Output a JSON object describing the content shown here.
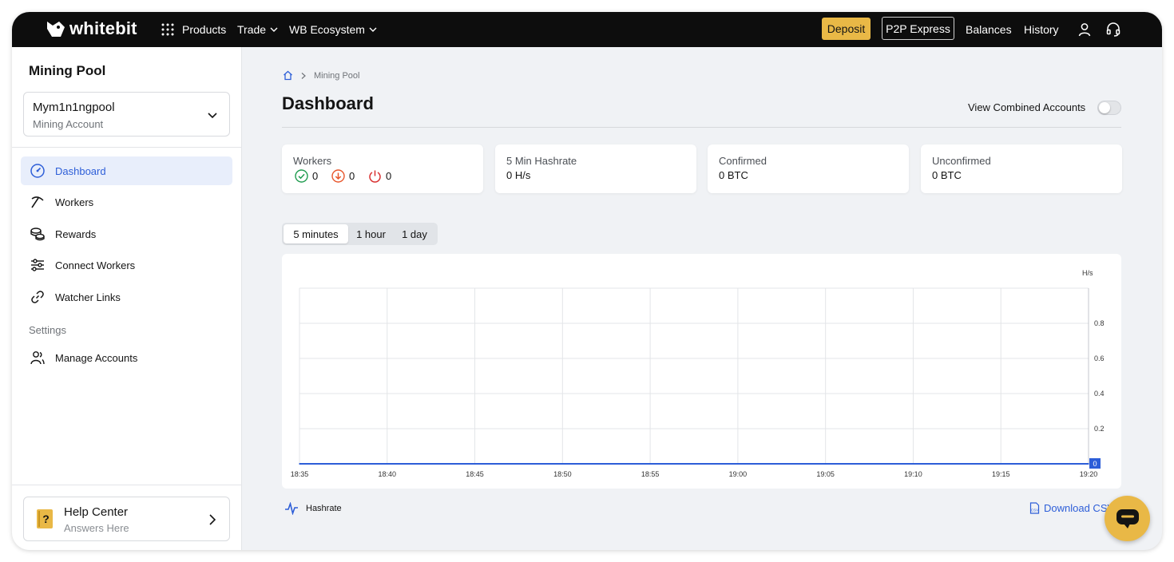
{
  "topbar": {
    "logo_text": "whitebit",
    "nav": [
      "Products",
      "Trade",
      "WB Ecosystem"
    ],
    "deposit_label": "Deposit",
    "p2p_label": "P2P Express",
    "balances_label": "Balances",
    "history_label": "History",
    "icons": [
      "grid-icon",
      "user-icon",
      "headset-icon"
    ]
  },
  "sidebar": {
    "title": "Mining Pool",
    "account": {
      "name": "Mym1n1ngpool",
      "type": "Mining Account"
    },
    "items": [
      {
        "label": "Dashboard",
        "icon": "gauge-icon",
        "active": true
      },
      {
        "label": "Workers",
        "icon": "pickaxe-icon",
        "active": false
      },
      {
        "label": "Rewards",
        "icon": "coins-icon",
        "active": false
      },
      {
        "label": "Connect Workers",
        "icon": "sliders-icon",
        "active": false
      },
      {
        "label": "Watcher Links",
        "icon": "link-icon",
        "active": false
      }
    ],
    "settings_label": "Settings",
    "settings_items": [
      {
        "label": "Manage Accounts",
        "icon": "users-icon"
      }
    ],
    "help": {
      "title": "Help Center",
      "subtitle": "Answers Here"
    }
  },
  "main": {
    "breadcrumb": [
      "Mining Pool"
    ],
    "title": "Dashboard",
    "combined_label": "View Combined Accounts",
    "combined_enabled": false,
    "cards": {
      "workers": {
        "label": "Workers",
        "online": "0",
        "offline": "0",
        "dead": "0"
      },
      "hashrate": {
        "label": "5 Min Hashrate",
        "value": "0 H/s"
      },
      "confirmed": {
        "label": "Confirmed",
        "value": "0 BTC"
      },
      "unconfirmed": {
        "label": "Unconfirmed",
        "value": "0 BTC"
      }
    },
    "ranges": [
      "5 minutes",
      "1 hour",
      "1 day"
    ],
    "active_range": "5 minutes",
    "legend_label": "Hashrate",
    "download_label": "Download CSV"
  },
  "colors": {
    "accent": "#2d5ed8",
    "brand_yellow": "#e9b846",
    "topbar": "#0d0d0d",
    "online": "#1e9b4e",
    "offline": "#e8562b",
    "dead": "#d93131"
  },
  "chart_data": {
    "type": "line",
    "x": [
      "18:35",
      "18:40",
      "18:45",
      "18:50",
      "18:55",
      "19:00",
      "19:05",
      "19:10",
      "19:15",
      "19:20"
    ],
    "series": [
      {
        "name": "Hashrate",
        "values": [
          0,
          0,
          0,
          0,
          0,
          0,
          0,
          0,
          0,
          0
        ]
      }
    ],
    "y_ticks": [
      "0.2",
      "0.4",
      "0.6",
      "0.8"
    ],
    "ylabel": "H/s",
    "ylim": [
      0,
      1
    ],
    "last_value_label": "0",
    "grid": true,
    "legend": "bottom-left"
  }
}
